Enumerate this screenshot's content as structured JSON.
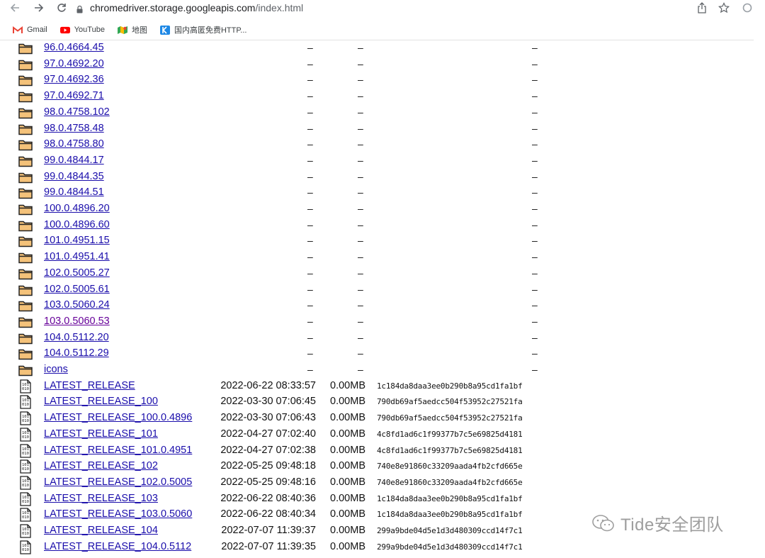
{
  "browser": {
    "url_host": "chromedriver.storage.googleapis.com",
    "url_path": "/index.html"
  },
  "bookmarks": [
    {
      "label": "Gmail",
      "icon": "gmail-icon"
    },
    {
      "label": "YouTube",
      "icon": "youtube-icon"
    },
    {
      "label": "地图",
      "icon": "maps-icon"
    },
    {
      "label": "国内高匿免费HTTP...",
      "icon": "proxy-site-icon"
    }
  ],
  "directories": [
    {
      "name": "96.0.4664.45",
      "date": "–",
      "size": "–",
      "hash": "–"
    },
    {
      "name": "97.0.4692.20",
      "date": "–",
      "size": "–",
      "hash": "–"
    },
    {
      "name": "97.0.4692.36",
      "date": "–",
      "size": "–",
      "hash": "–"
    },
    {
      "name": "97.0.4692.71",
      "date": "–",
      "size": "–",
      "hash": "–"
    },
    {
      "name": "98.0.4758.102",
      "date": "–",
      "size": "–",
      "hash": "–"
    },
    {
      "name": "98.0.4758.48",
      "date": "–",
      "size": "–",
      "hash": "–"
    },
    {
      "name": "98.0.4758.80",
      "date": "–",
      "size": "–",
      "hash": "–"
    },
    {
      "name": "99.0.4844.17",
      "date": "–",
      "size": "–",
      "hash": "–"
    },
    {
      "name": "99.0.4844.35",
      "date": "–",
      "size": "–",
      "hash": "–"
    },
    {
      "name": "99.0.4844.51",
      "date": "–",
      "size": "–",
      "hash": "–"
    },
    {
      "name": "100.0.4896.20",
      "date": "–",
      "size": "–",
      "hash": "–"
    },
    {
      "name": "100.0.4896.60",
      "date": "–",
      "size": "–",
      "hash": "–"
    },
    {
      "name": "101.0.4951.15",
      "date": "–",
      "size": "–",
      "hash": "–"
    },
    {
      "name": "101.0.4951.41",
      "date": "–",
      "size": "–",
      "hash": "–"
    },
    {
      "name": "102.0.5005.27",
      "date": "–",
      "size": "–",
      "hash": "–"
    },
    {
      "name": "102.0.5005.61",
      "date": "–",
      "size": "–",
      "hash": "–"
    },
    {
      "name": "103.0.5060.24",
      "date": "–",
      "size": "–",
      "hash": "–"
    },
    {
      "name": "103.0.5060.53",
      "date": "–",
      "size": "–",
      "hash": "–",
      "visited": true
    },
    {
      "name": "104.0.5112.20",
      "date": "–",
      "size": "–",
      "hash": "–"
    },
    {
      "name": "104.0.5112.29",
      "date": "–",
      "size": "–",
      "hash": "–"
    },
    {
      "name": "icons",
      "date": "–",
      "size": "–",
      "hash": "–"
    }
  ],
  "files": [
    {
      "name": "LATEST_RELEASE",
      "date": "2022-06-22 08:33:57",
      "size": "0.00MB",
      "hash": "1c184da8daa3ee0b290b8a95cd1fa1bf"
    },
    {
      "name": "LATEST_RELEASE_100",
      "date": "2022-03-30 07:06:45",
      "size": "0.00MB",
      "hash": "790db69af5aedcc504f53952c27521fa"
    },
    {
      "name": "LATEST_RELEASE_100.0.4896",
      "date": "2022-03-30 07:06:43",
      "size": "0.00MB",
      "hash": "790db69af5aedcc504f53952c27521fa"
    },
    {
      "name": "LATEST_RELEASE_101",
      "date": "2022-04-27 07:02:40",
      "size": "0.00MB",
      "hash": "4c8fd1ad6c1f99377b7c5e69825d4181"
    },
    {
      "name": "LATEST_RELEASE_101.0.4951",
      "date": "2022-04-27 07:02:38",
      "size": "0.00MB",
      "hash": "4c8fd1ad6c1f99377b7c5e69825d4181"
    },
    {
      "name": "LATEST_RELEASE_102",
      "date": "2022-05-25 09:48:18",
      "size": "0.00MB",
      "hash": "740e8e91860c33209aada4fb2cfd665e"
    },
    {
      "name": "LATEST_RELEASE_102.0.5005",
      "date": "2022-05-25 09:48:16",
      "size": "0.00MB",
      "hash": "740e8e91860c33209aada4fb2cfd665e"
    },
    {
      "name": "LATEST_RELEASE_103",
      "date": "2022-06-22 08:40:36",
      "size": "0.00MB",
      "hash": "1c184da8daa3ee0b290b8a95cd1fa1bf"
    },
    {
      "name": "LATEST_RELEASE_103.0.5060",
      "date": "2022-06-22 08:40:34",
      "size": "0.00MB",
      "hash": "1c184da8daa3ee0b290b8a95cd1fa1bf"
    },
    {
      "name": "LATEST_RELEASE_104",
      "date": "2022-07-07 11:39:37",
      "size": "0.00MB",
      "hash": "299a9bde04d5e1d3d480309ccd14f7c1"
    },
    {
      "name": "LATEST_RELEASE_104.0.5112",
      "date": "2022-07-07 11:39:35",
      "size": "0.00MB",
      "hash": "299a9bde04d5e1d3d480309ccd14f7c1"
    }
  ],
  "watermark": {
    "text": "Tide安全团队"
  }
}
